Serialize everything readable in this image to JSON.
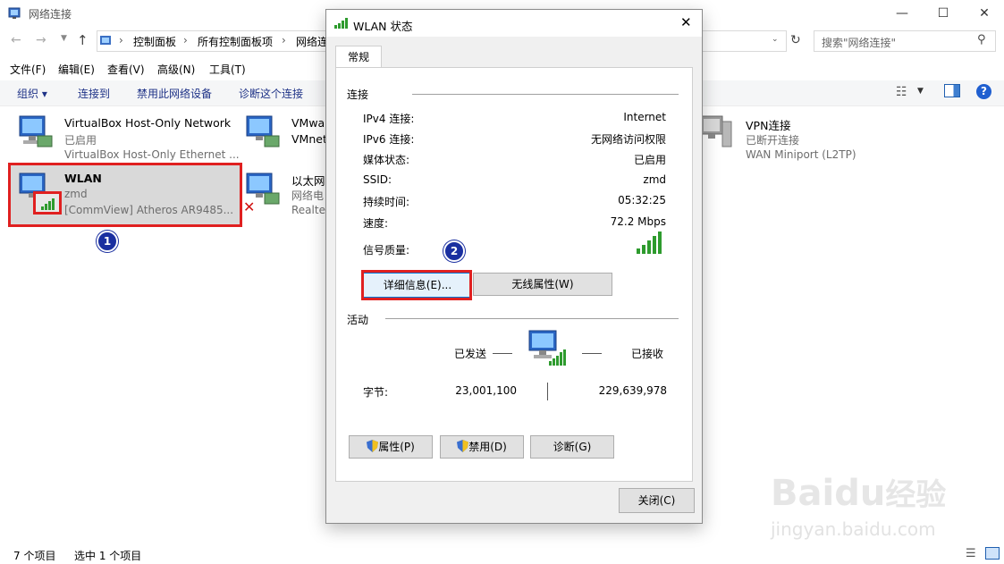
{
  "explorer": {
    "title": "网络连接",
    "breadcrumb": [
      "控制面板",
      "所有控制面板项",
      "网络连"
    ],
    "search_placeholder": "搜索\"网络连接\"",
    "menu": [
      "文件(F)",
      "编辑(E)",
      "查看(V)",
      "高级(N)",
      "工具(T)"
    ],
    "commands": [
      "组织 ▾",
      "连接到",
      "禁用此网络设备",
      "诊断这个连接"
    ],
    "status": {
      "items": "7 个项目",
      "selected": "选中 1 个项目"
    }
  },
  "connections": [
    {
      "name": "VirtualBox Host-Only Network",
      "status": "已启用",
      "device": "VirtualBox Host-Only Ethernet ..."
    },
    {
      "name": "WLAN",
      "status": "zmd",
      "device": "[CommView] Atheros AR9485..."
    },
    {
      "name": "VMwar",
      "status": "VMnet",
      "device": ""
    },
    {
      "name": "以太网",
      "status": "网络电",
      "device": "Realtel"
    },
    {
      "name": "VPN连接",
      "status": "已断开连接",
      "device": "WAN Miniport (L2TP)"
    }
  ],
  "annotations": {
    "badge1": "1",
    "badge2": "2"
  },
  "dialog": {
    "title": "WLAN 状态",
    "tab": "常规",
    "section_connection": "连接",
    "rows": [
      {
        "label": "IPv4 连接:",
        "value": "Internet"
      },
      {
        "label": "IPv6 连接:",
        "value": "无网络访问权限"
      },
      {
        "label": "媒体状态:",
        "value": "已启用"
      },
      {
        "label": "SSID:",
        "value": "zmd"
      },
      {
        "label": "持续时间:",
        "value": "05:32:25"
      },
      {
        "label": "速度:",
        "value": "72.2 Mbps"
      }
    ],
    "signal_label": "信号质量:",
    "signal_level": 5,
    "btn_details": "详细信息(E)...",
    "btn_wireless": "无线属性(W)",
    "section_activity": "活动",
    "sent_label": "已发送",
    "received_label": "已接收",
    "bytes_label": "字节:",
    "bytes_sent": "23,001,100",
    "bytes_received": "229,639,978",
    "btn_properties": "属性(P)",
    "btn_disable": "禁用(D)",
    "btn_diagnose": "诊断(G)",
    "btn_close": "关闭(C)"
  },
  "watermark": {
    "brand": "Bai",
    "brand2": "du",
    "cn": "经验",
    "url": "jingyan.baidu.com"
  },
  "colors": {
    "accent": "#1a2fa0",
    "highlight": "#e02020",
    "signal": "#2e9b2e"
  }
}
